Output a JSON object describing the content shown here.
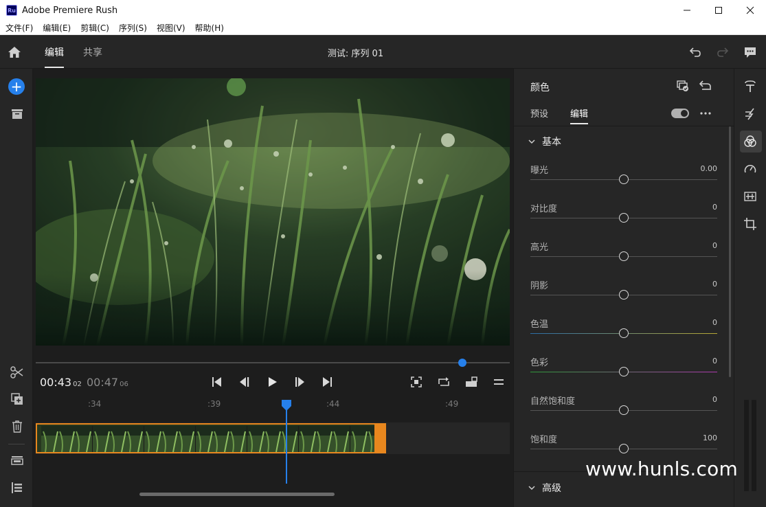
{
  "window": {
    "app_icon_text": "Ru",
    "title": "Adobe Premiere Rush"
  },
  "menu": [
    "文件(F)",
    "编辑(E)",
    "剪辑(C)",
    "序列(S)",
    "视图(V)",
    "帮助(H)"
  ],
  "topbar": {
    "tabs": [
      {
        "label": "编辑",
        "active": true
      },
      {
        "label": "共享",
        "active": false
      }
    ],
    "project_title": "测试: 序列 01"
  },
  "leftbar": {
    "add_label": "+"
  },
  "player": {
    "scrub_position": 0.9,
    "current_time": "00:43",
    "current_frames": "02",
    "duration": "00:47",
    "duration_frames": "06"
  },
  "timeline": {
    "ruler_labels": [
      ":34",
      ":39",
      ":44",
      ":49"
    ],
    "playhead_time": ":43",
    "clip_thumbnails": 7
  },
  "panel": {
    "title": "颜色",
    "tabs": [
      {
        "label": "预设",
        "active": false
      },
      {
        "label": "编辑",
        "active": true
      }
    ],
    "toggle_on": true,
    "section_basic": "基本",
    "section_advanced": "高级",
    "sliders": [
      {
        "label": "曝光",
        "value": "0.00",
        "position": 0.5,
        "color": "#555555"
      },
      {
        "label": "对比度",
        "value": "0",
        "position": 0.5,
        "color": "#555555"
      },
      {
        "label": "高光",
        "value": "0",
        "position": 0.5,
        "color": "#555555"
      },
      {
        "label": "阴影",
        "value": "0",
        "position": 0.5,
        "color": "#555555"
      },
      {
        "label": "色温",
        "value": "0",
        "position": 0.5,
        "gradient": [
          "#2b6ea8",
          "#b8a935"
        ]
      },
      {
        "label": "色彩",
        "value": "0",
        "position": 0.5,
        "gradient": [
          "#2f9a3a",
          "#b03ab0"
        ]
      },
      {
        "label": "自然饱和度",
        "value": "0",
        "position": 0.5,
        "color": "#555555"
      },
      {
        "label": "饱和度",
        "value": "100",
        "position": 0.5,
        "color": "#555555"
      }
    ]
  },
  "colors": {
    "accent": "#2680eb",
    "clip_border": "#e8871e"
  },
  "watermark": "www.hunls.com"
}
